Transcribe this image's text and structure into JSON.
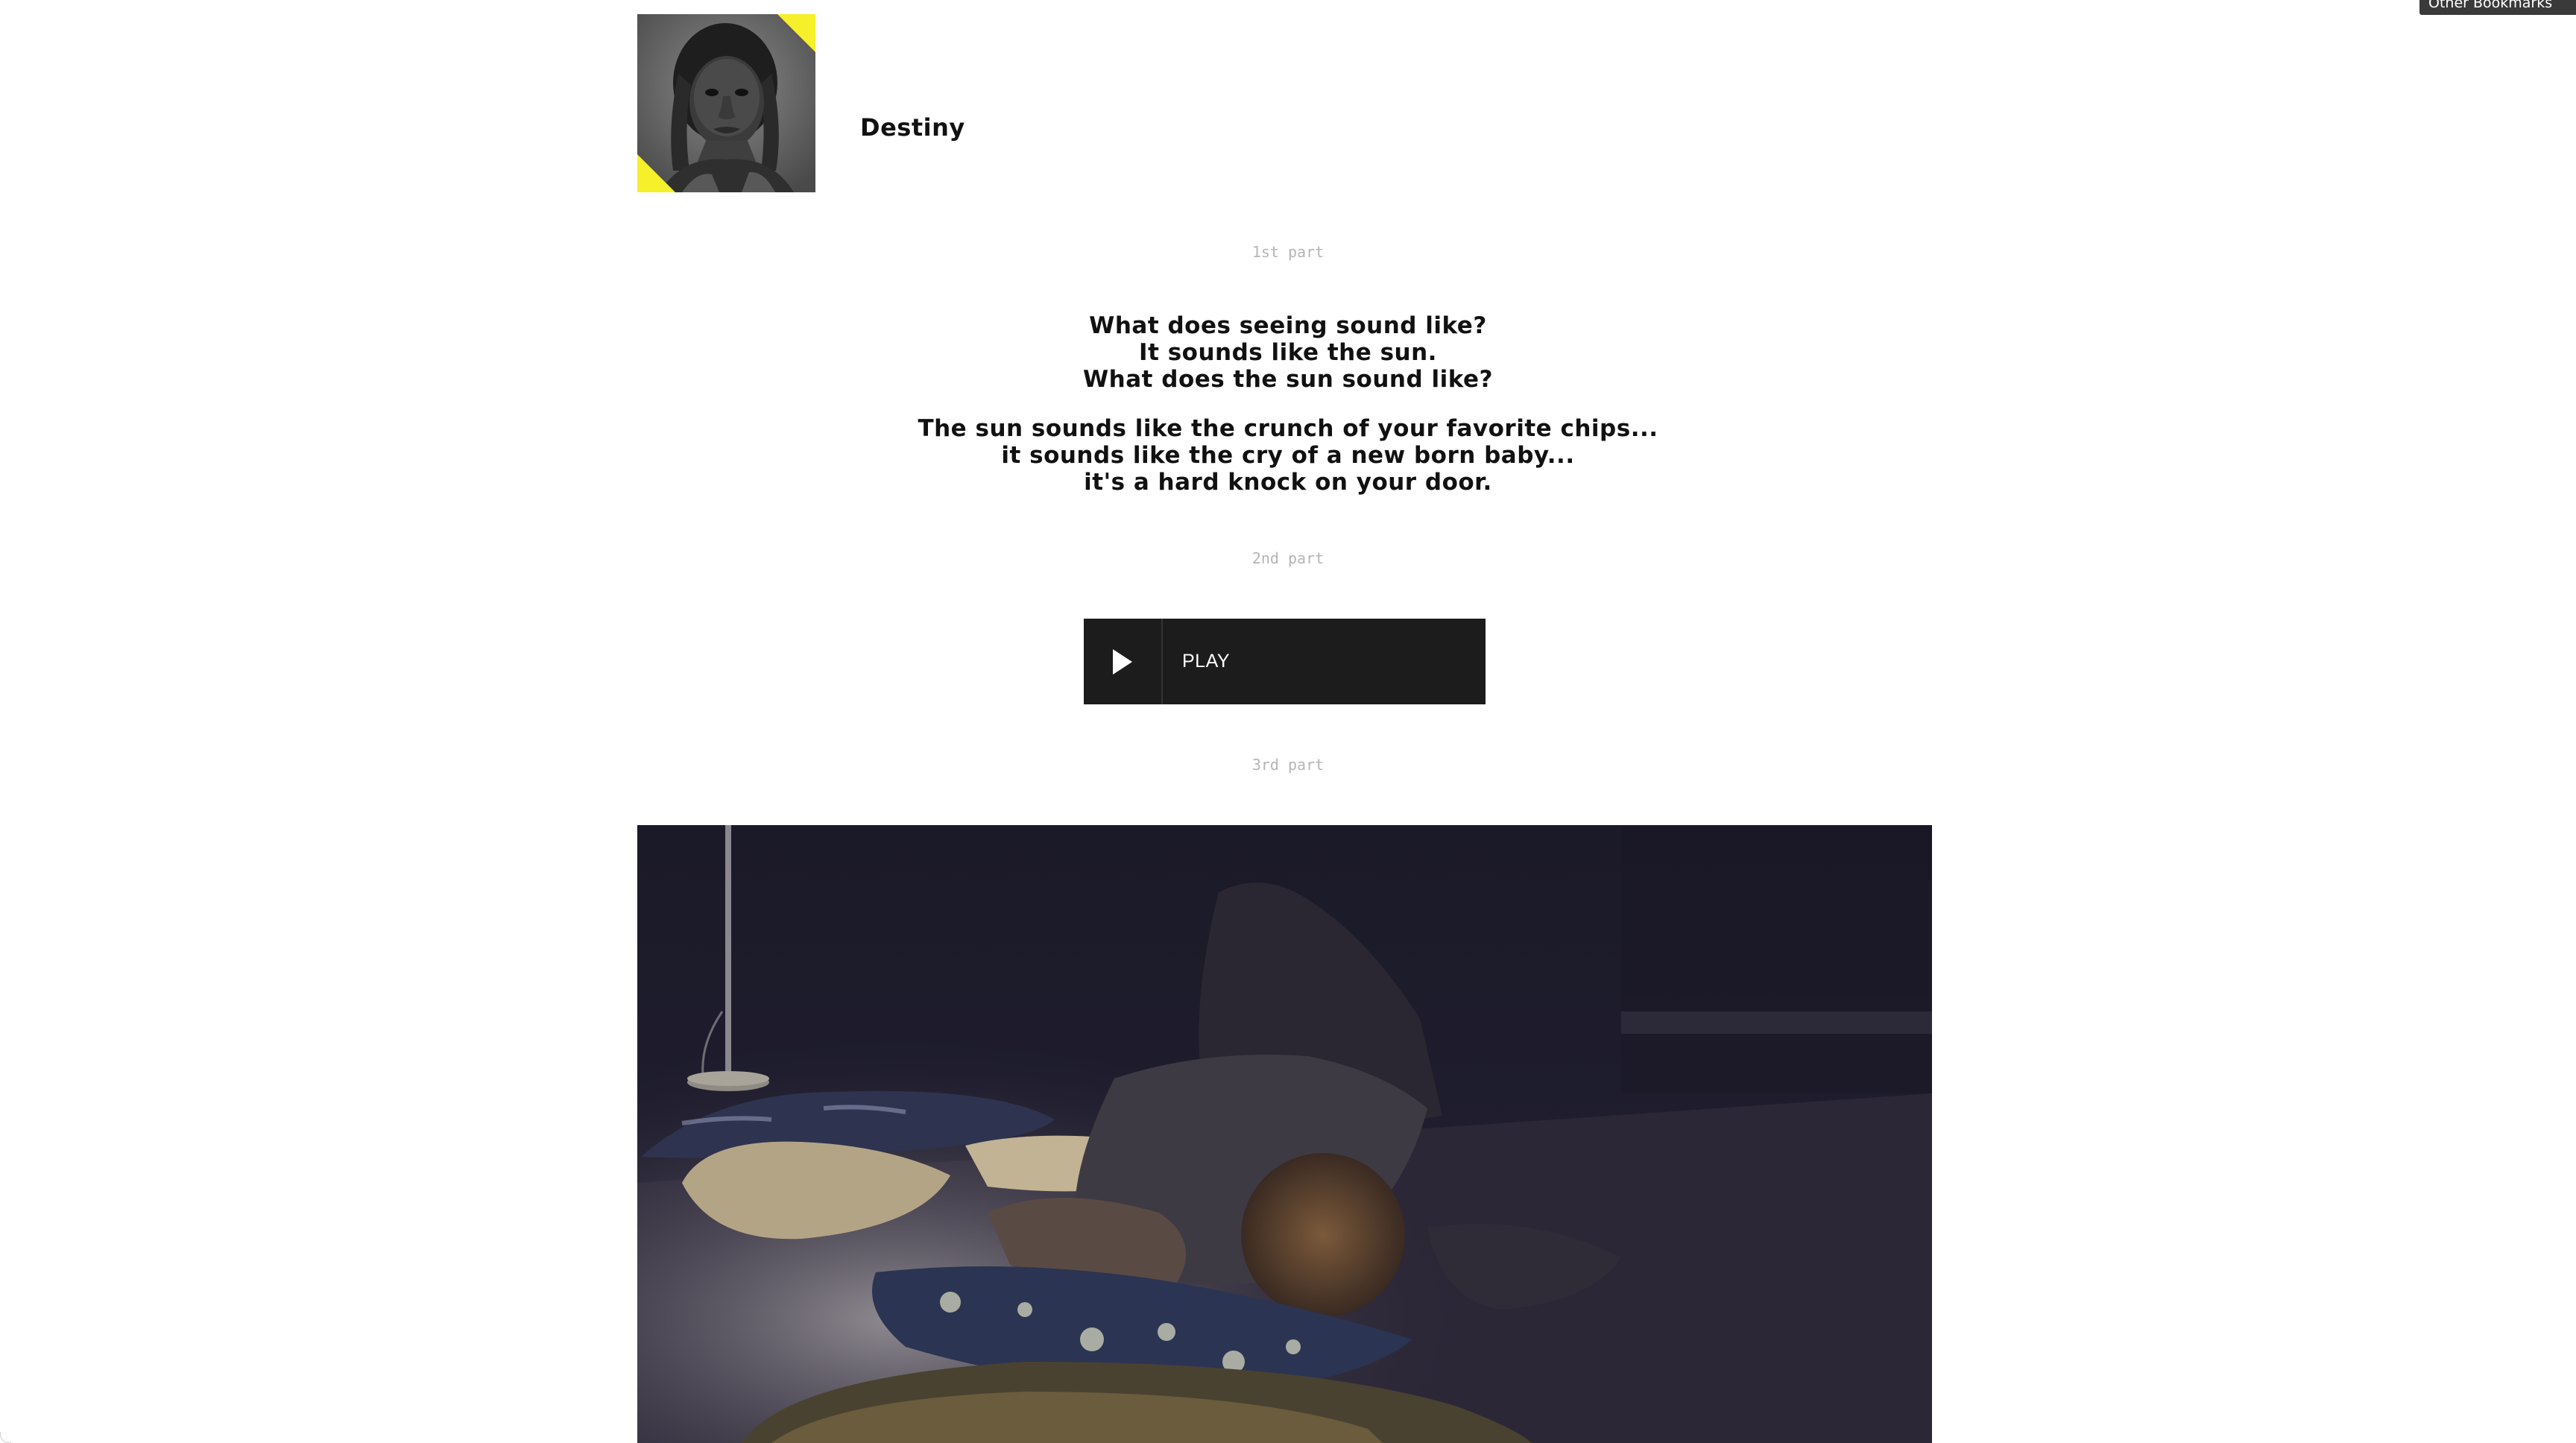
{
  "browser": {
    "bookmarks_label": "Other Bookmarks"
  },
  "profile": {
    "name": "Destiny",
    "avatar_accent": "#f5f02a"
  },
  "sections": {
    "part1_label": "1st part",
    "part2_label": "2nd part",
    "part3_label": "3rd part"
  },
  "poem": {
    "stanza1": [
      "What does seeing sound like?",
      "It sounds like the sun.",
      "What does the sun sound like?"
    ],
    "stanza2": [
      "The sun sounds like the crunch of your favorite chips...",
      "it sounds like the cry of a new born baby...",
      "it's a hard knock on your door."
    ]
  },
  "audio_player": {
    "play_label": "PLAY",
    "icon": "play-icon",
    "background": "#1c1c1c"
  },
  "video": {
    "icon": "video-still"
  }
}
